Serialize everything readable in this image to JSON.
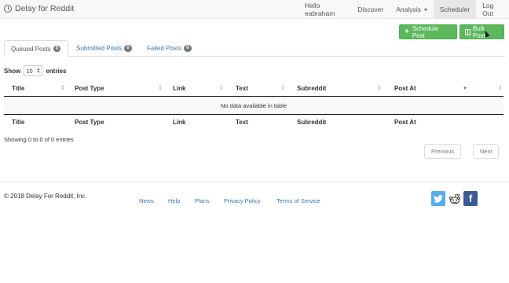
{
  "app": {
    "brand": "Delay for Reddit"
  },
  "nav": {
    "items": [
      "Hello eabraham",
      "Discover",
      "Analysis",
      "Scheduler",
      "Log Out"
    ],
    "active": "Scheduler"
  },
  "actions": {
    "schedule_post": "Schedule Post",
    "bulk_post": "Bulk Post"
  },
  "tabs": [
    {
      "label": "Queued Posts",
      "count": "0"
    },
    {
      "label": "Submitted Posts",
      "count": "0"
    },
    {
      "label": "Failed Posts",
      "count": "0"
    }
  ],
  "table": {
    "show_label": "Show",
    "page_size": "10",
    "entries_label": "entries",
    "columns": [
      "Title",
      "Post Type",
      "Link",
      "Text",
      "Subreddit",
      "Post At"
    ],
    "empty_message": "No data available in table",
    "info": "Showing 0 to 0 of 0 entries",
    "previous": "Previous",
    "next": "Next"
  },
  "footer": {
    "copyright": "© 2018 Delay For Reddit, Inc.",
    "links": [
      "News",
      "Help",
      "Plans",
      "Privacy Policy",
      "Terms of Service"
    ]
  },
  "colors": {
    "green": "#5cb85c",
    "link": "#337ab7",
    "twitter": "#55acee",
    "facebook": "#3b5998"
  }
}
